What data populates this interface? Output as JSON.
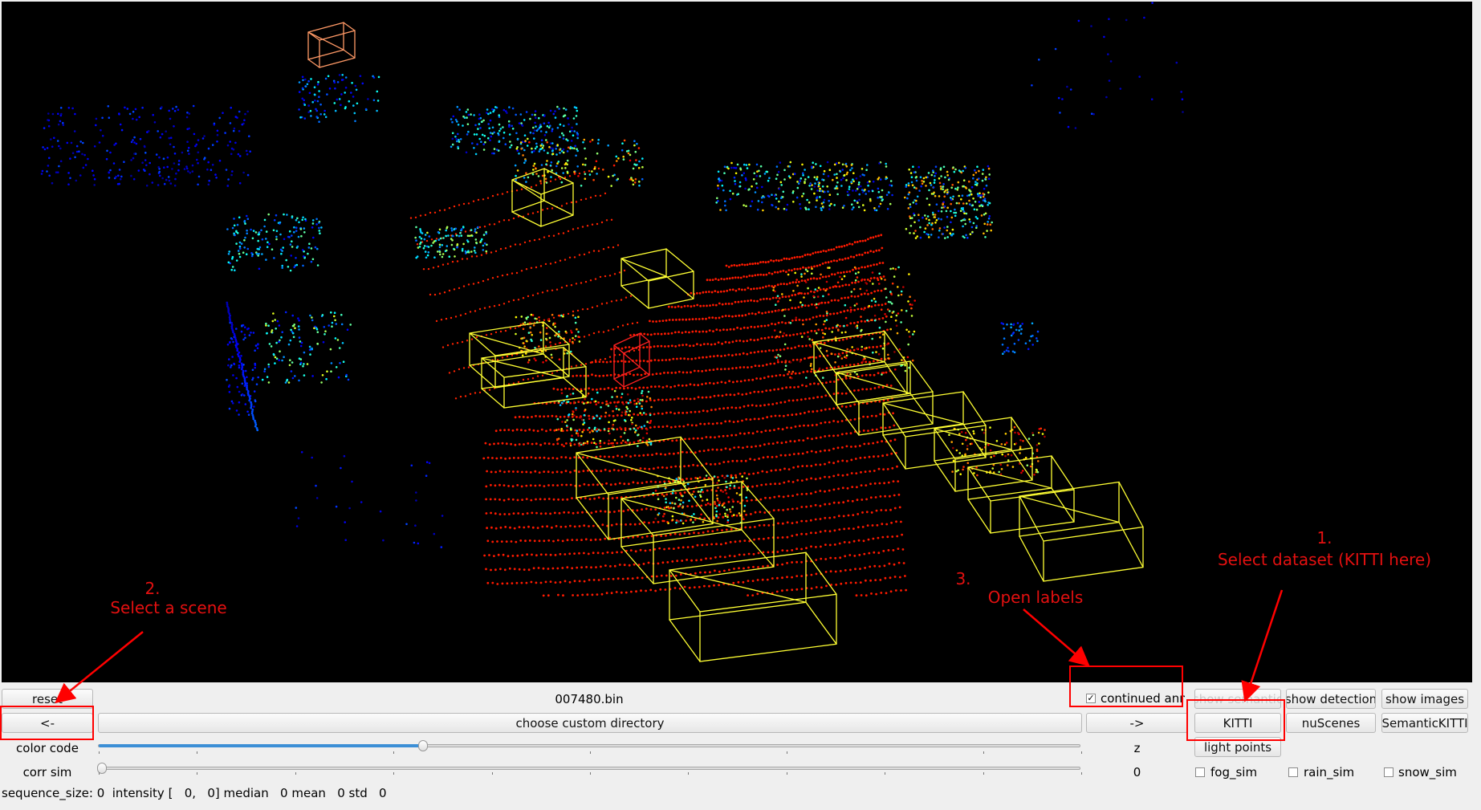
{
  "viewer": {
    "file_name": "007480.bin",
    "reset_label": "reset",
    "prev_label": "<-",
    "next_label": "->",
    "choose_dir_label": "choose custom directory",
    "continued_anns_label": "continued anns",
    "continued_anns_checked": true,
    "show_semantic_label": "show semantic",
    "show_detection_label": "show detection",
    "show_images_label": "show images",
    "dataset_buttons": [
      "KITTI",
      "nuScenes",
      "SemanticKITTI"
    ],
    "color_code_label": "color code",
    "color_code_value_label": "z",
    "light_points_label": "light points",
    "corr_sim_label": "corr sim",
    "corr_sim_value": "0",
    "color_code_slider_fraction": 0.33,
    "corr_sim_slider_fraction": 0.0,
    "sims": [
      {
        "label": "fog_sim",
        "checked": false
      },
      {
        "label": "rain_sim",
        "checked": false
      },
      {
        "label": "snow_sim",
        "checked": false
      }
    ],
    "status_line": "sequence_size: 0  intensity [   0,   0] median   0 mean   0 std   0"
  },
  "annotations": {
    "step1_number": "1.",
    "step1_text": "Select dataset (KITTI here)",
    "step2_number": "2.",
    "step2_text": "Select a scene",
    "step3_number": "3.",
    "step3_text": "Open labels"
  },
  "colors": {
    "annotation_red": "#ff0000",
    "box_yellow": "#ffff33",
    "box_orange": "#ff9966",
    "slider_blue": "#3c8fd6"
  }
}
